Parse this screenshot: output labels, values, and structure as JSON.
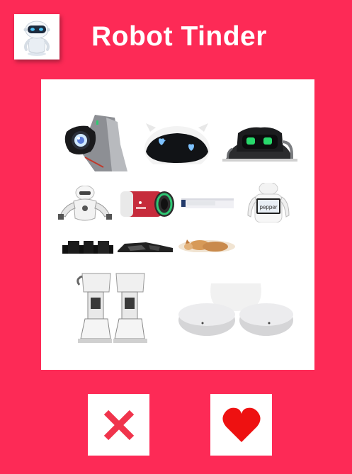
{
  "header": {
    "title": "Robot Tinder",
    "logo_icon": "robot-avatar-icon"
  },
  "card": {
    "images": [
      "vector-robot-close-up",
      "eilik-robot-with-heart-eyes",
      "vector-robot-green-eyes",
      "nao-humanoid-robot",
      "cylindrical-red-robot",
      "robot-strip",
      "pepper-robot-with-tablet",
      "robot-treads",
      "robot-treads-2",
      "cat-photo",
      "humanoid-robot-legs",
      "white-round-robot-feet"
    ]
  },
  "actions": {
    "reject_icon": "x-icon",
    "like_icon": "heart-icon"
  },
  "colors": {
    "background": "#fd2a56",
    "reject": "#f0344c",
    "like": "#ee1111",
    "card": "#ffffff"
  }
}
